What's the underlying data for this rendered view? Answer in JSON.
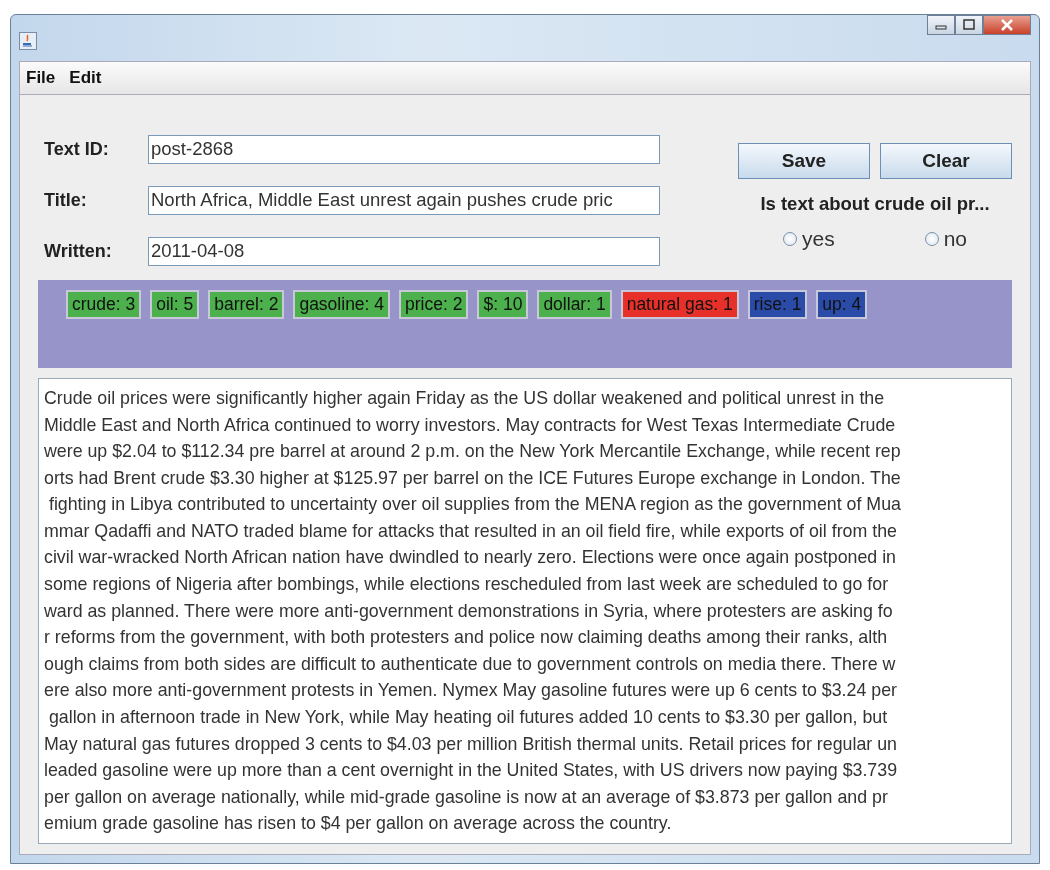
{
  "menu": [
    {
      "label": "File"
    },
    {
      "label": "Edit"
    }
  ],
  "form": {
    "fields": [
      {
        "label": "Text ID:",
        "value": "post-2868"
      },
      {
        "label": "Title:",
        "value": "North Africa, Middle East unrest again pushes crude pric"
      },
      {
        "label": "Written:",
        "value": "2011-04-08"
      }
    ],
    "buttons": [
      "Save",
      "Clear"
    ],
    "question": "Is text about crude oil pr...",
    "options": [
      {
        "label": "yes",
        "selected": false
      },
      {
        "label": "no",
        "selected": false
      }
    ]
  },
  "tags": [
    {
      "label": "crude: 3",
      "color": "#4cb04c"
    },
    {
      "label": "oil: 5",
      "color": "#4cb04c"
    },
    {
      "label": "barrel: 2",
      "color": "#4cb04c"
    },
    {
      "label": "gasoline: 4",
      "color": "#4cb04c"
    },
    {
      "label": "price: 2",
      "color": "#4cb04c"
    },
    {
      "label": "$: 10",
      "color": "#4cb04c"
    },
    {
      "label": "dollar: 1",
      "color": "#4cb04c"
    },
    {
      "label": "natural gas: 1",
      "color": "#e8302a"
    },
    {
      "label": "rise: 1",
      "color": "#2a4ca8"
    },
    {
      "label": "up: 4",
      "color": "#2a4ca8"
    }
  ],
  "text_lines": [
    "Crude oil prices were significantly higher again Friday as the US dollar weakened and political unrest in the",
    "Middle East and North Africa continued to worry investors. May contracts for West Texas Intermediate Crude",
    "were up $2.04 to $112.34 pre barrel at around 2 p.m. on the New York Mercantile Exchange, while recent rep",
    "orts had Brent crude $3.30 higher at $125.97 per barrel on the ICE Futures Europe exchange in London. The",
    " fighting in Libya contributed to uncertainty over oil supplies from the MENA region as the government of Mua",
    "mmar Qadaffi and NATO traded blame for attacks that resulted in an oil field fire, while exports of oil from the",
    "civil war-wracked North African nation have dwindled to nearly zero. Elections were once again postponed in",
    "some regions of Nigeria after bombings, while elections rescheduled from last week are scheduled to go for",
    "ward as planned. There were more anti-government demonstrations in Syria, where protesters are asking fo",
    "r reforms from the government, with both protesters and police now claiming deaths among their ranks, alth",
    "ough claims from both sides are difficult to authenticate due to government controls on media there. There w",
    "ere also more anti-government protests in Yemen. Nymex May gasoline futures were up 6 cents to $3.24 per",
    " gallon in afternoon trade in New York, while May heating oil futures added 10 cents to $3.30 per gallon, but",
    "May natural gas futures dropped 3 cents to $4.03 per million British thermal units. Retail prices for regular un",
    "leaded gasoline were up more than a cent overnight in the United States, with US drivers now paying $3.739",
    "per gallon on average nationally, while mid-grade gasoline is now at an average of $3.873 per gallon and pr",
    "emium grade gasoline has risen to $4 per gallon on average across the country."
  ]
}
